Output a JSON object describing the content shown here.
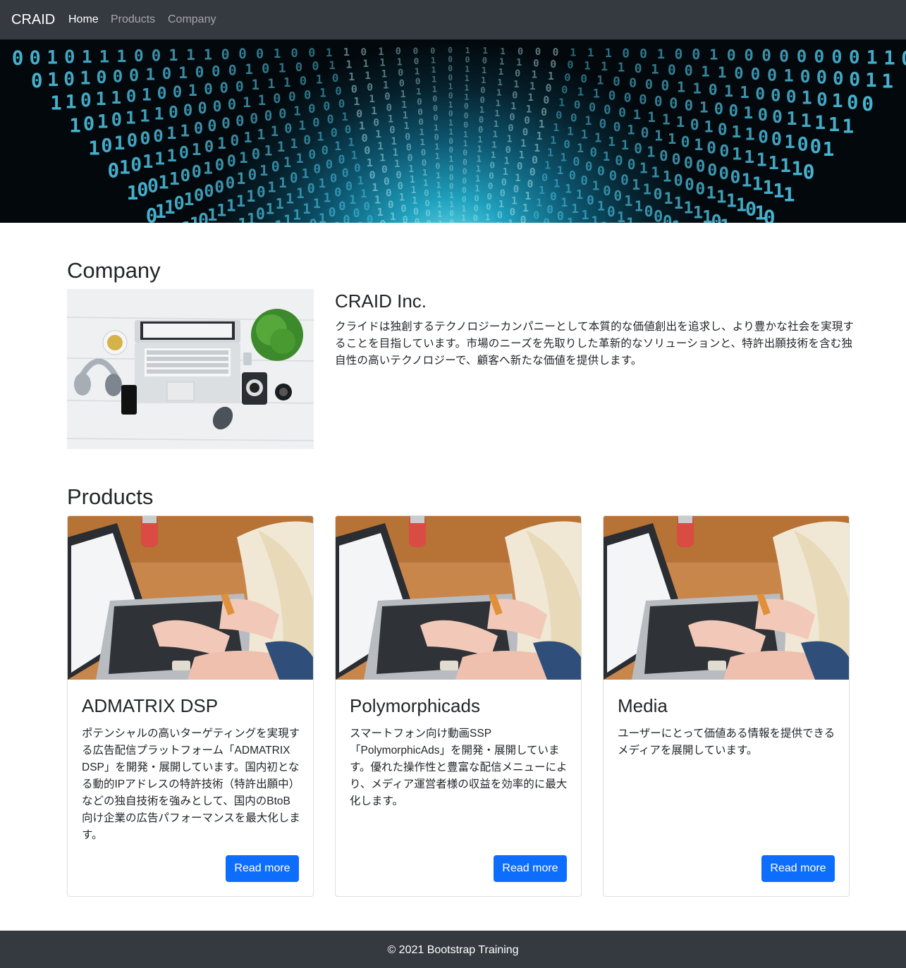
{
  "navbar": {
    "brand": "CRAID",
    "links": [
      {
        "label": "Home",
        "active": true
      },
      {
        "label": "Products",
        "active": false
      },
      {
        "label": "Company",
        "active": false
      }
    ]
  },
  "hero": {
    "image": "binary-code-tunnel"
  },
  "company": {
    "heading": "Company",
    "image": "desk-laptop-top-view",
    "name": "CRAID Inc.",
    "description": "クライドは独創するテクノロジーカンパニーとして本質的な価値創出を追求し、より豊かな社会を実現することを目指しています。市場のニーズを先取りした革新的なソリューションと、特許出願技術を含む独自性の高いテクノロジーで、顧客へ新たな価値を提供します。"
  },
  "products": {
    "heading": "Products",
    "items": [
      {
        "title": "ADMATRIX DSP",
        "text": "ポテンシャルの高いターゲティングを実現する広告配信プラットフォーム「ADMATRIX DSP」を開発・展開しています。国内初となる動的IPアドレスの特許技術（特許出願中）などの独自技術を強みとして、国内のBtoB向け企業の広告パフォーマンスを最大化します。",
        "button": "Read more",
        "image": "person-typing-laptop"
      },
      {
        "title": "Polymorphicads",
        "text": "スマートフォン向け動画SSP「PolymorphicAds」を開発・展開しています。優れた操作性と豊富な配信メニューにより、メディア運営者様の収益を効率的に最大化します。",
        "button": "Read more",
        "image": "person-typing-laptop"
      },
      {
        "title": "Media",
        "text": "ユーザーにとって価値ある情報を提供できるメディアを展開しています。",
        "button": "Read more",
        "image": "person-typing-laptop"
      }
    ]
  },
  "footer": {
    "text": "© 2021 Bootstrap Training"
  },
  "colors": {
    "navbar_bg": "#343a40",
    "primary_button": "#0d6efd",
    "hero_glow": "#6fe3f2"
  }
}
